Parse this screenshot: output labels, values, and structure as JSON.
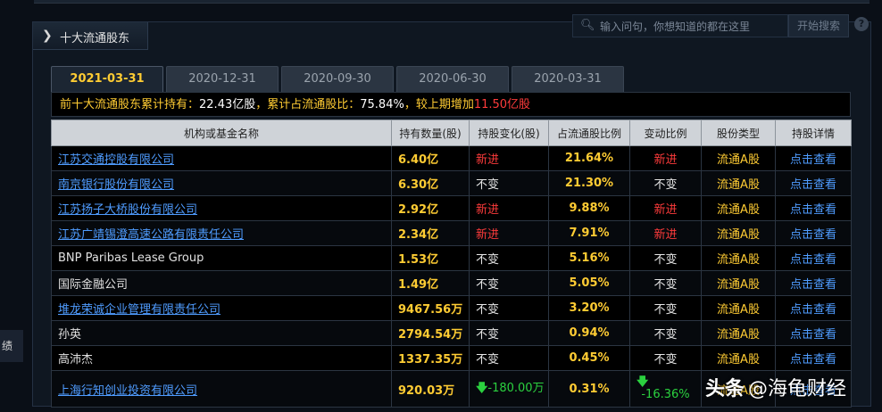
{
  "panel": {
    "title": "十大流通股东"
  },
  "search": {
    "placeholder": "输入问句，你想知道的都在这里",
    "button": "开始搜索",
    "help": "?"
  },
  "tabs": [
    {
      "label": "2021-03-31",
      "active": true
    },
    {
      "label": "2020-12-31",
      "active": false
    },
    {
      "label": "2020-09-30",
      "active": false
    },
    {
      "label": "2020-06-30",
      "active": false
    },
    {
      "label": "2020-03-31",
      "active": false
    }
  ],
  "summary": {
    "prefix": "前十大流通股东累计持有：",
    "total": "22.43亿股",
    "sep1": "，累计占流通股比：",
    "ratio": "75.84%",
    "sep2": "，较上期增加",
    "increase": "11.50亿股"
  },
  "columns": [
    "机构或基金名称",
    "持有数量(股)",
    "持股变化(股)",
    "占流通股比例",
    "变动比例",
    "股份类型",
    "持股详情"
  ],
  "rows": [
    {
      "name": "江苏交通控股有限公司",
      "link": true,
      "qty": "6.40亿",
      "change": "新进",
      "ratio": "21.64%",
      "change_ratio": "新进",
      "type": "流通A股",
      "detail": "点击查看"
    },
    {
      "name": "南京银行股份有限公司",
      "link": true,
      "qty": "6.30亿",
      "change": "不变",
      "ratio": "21.30%",
      "change_ratio": "不变",
      "type": "流通A股",
      "detail": "点击查看"
    },
    {
      "name": "江苏扬子大桥股份有限公司",
      "link": true,
      "qty": "2.92亿",
      "change": "新进",
      "ratio": "9.88%",
      "change_ratio": "新进",
      "type": "流通A股",
      "detail": "点击查看"
    },
    {
      "name": "江苏广靖锡澄高速公路有限责任公司",
      "link": true,
      "qty": "2.34亿",
      "change": "新进",
      "ratio": "7.91%",
      "change_ratio": "新进",
      "type": "流通A股",
      "detail": "点击查看"
    },
    {
      "name": "BNP Paribas Lease Group",
      "link": false,
      "qty": "1.53亿",
      "change": "不变",
      "ratio": "5.16%",
      "change_ratio": "不变",
      "type": "流通A股",
      "detail": "点击查看"
    },
    {
      "name": "国际金融公司",
      "link": false,
      "qty": "1.49亿",
      "change": "不变",
      "ratio": "5.05%",
      "change_ratio": "不变",
      "type": "流通A股",
      "detail": "点击查看"
    },
    {
      "name": "堆龙荣诚企业管理有限责任公司",
      "link": true,
      "qty": "9467.56万",
      "change": "不变",
      "ratio": "3.20%",
      "change_ratio": "不变",
      "type": "流通A股",
      "detail": "点击查看"
    },
    {
      "name": "孙英",
      "link": false,
      "qty": "2794.54万",
      "change": "不变",
      "ratio": "0.94%",
      "change_ratio": "不变",
      "type": "流通A股",
      "detail": "点击查看"
    },
    {
      "name": "高沛杰",
      "link": false,
      "qty": "1337.35万",
      "change": "不变",
      "ratio": "0.45%",
      "change_ratio": "不变",
      "type": "流通A股",
      "detail": "点击查看"
    },
    {
      "name": "上海行知创业投资有限公司",
      "link": true,
      "qty": "920.03万",
      "change": "-180.00万",
      "ratio": "0.31%",
      "change_ratio": "-16.36%",
      "type": "流通A股",
      "detail": "点击查看"
    }
  ],
  "left_strip": "绩",
  "watermark": {
    "brand": "头条",
    "author": "@海龟财经"
  },
  "colors": {
    "accent": "#ffcc33",
    "increase": "#ff3b3b",
    "decrease": "#2bd13f",
    "link": "#4f9cff"
  }
}
